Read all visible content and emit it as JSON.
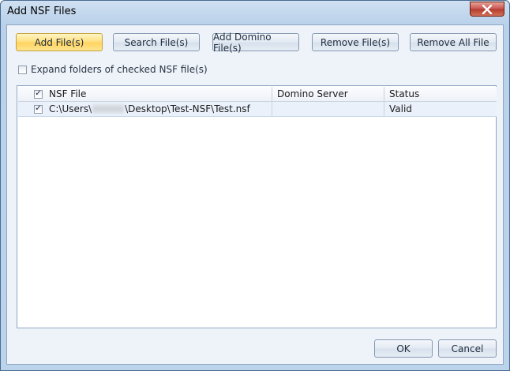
{
  "window": {
    "title": "Add NSF Files"
  },
  "toolbar": {
    "add_files": "Add File(s)",
    "search_files": "Search File(s)",
    "add_domino_files": "Add Domino File(s)",
    "remove_files": "Remove File(s)",
    "remove_all_file": "Remove All File"
  },
  "options": {
    "expand_folders_label": "Expand folders of checked NSF file(s)",
    "expand_folders_checked": false
  },
  "grid": {
    "columns": [
      "NSF File",
      "Domino Server",
      "Status"
    ],
    "header_checked": true,
    "rows": [
      {
        "checked": true,
        "path_prefix": "C:\\Users\\",
        "path_suffix": "\\Desktop\\Test-NSF\\Test.nsf",
        "server": "",
        "status": "Valid"
      }
    ]
  },
  "footer": {
    "ok": "OK",
    "cancel": "Cancel"
  }
}
